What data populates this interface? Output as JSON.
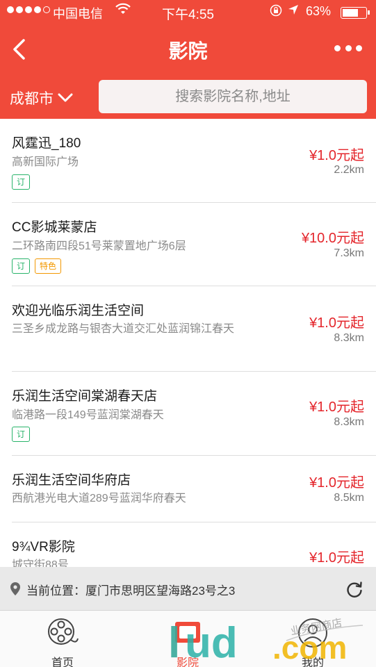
{
  "status_bar": {
    "carrier": "中国电信",
    "time": "下午4:55",
    "battery": "63%"
  },
  "nav": {
    "title": "影院"
  },
  "search": {
    "city": "成都市",
    "placeholder": "搜索影院名称,地址"
  },
  "cinemas": [
    {
      "name": "风霆迅_180",
      "address": "高新国际广场",
      "tags": [
        "订"
      ],
      "price": "¥1.0元起",
      "distance": "2.2km"
    },
    {
      "name": "CC影城莱蒙店",
      "address": "二环路南四段51号莱蒙置地广场6层",
      "tags": [
        "订",
        "特色"
      ],
      "price": "¥10.0元起",
      "distance": "7.3km"
    },
    {
      "name": "欢迎光临乐润生活空间",
      "address": "三圣乡成龙路与银杏大道交汇处蓝润锦江春天",
      "tags": [],
      "price": "¥1.0元起",
      "distance": "8.3km"
    },
    {
      "name": "乐润生活空间棠湖春天店",
      "address": "临港路一段149号蓝润棠湖春天",
      "tags": [
        "订"
      ],
      "price": "¥1.0元起",
      "distance": "8.3km"
    },
    {
      "name": "乐润生活空间华府店",
      "address": "西航港光电大道289号蓝润华府春天",
      "tags": [],
      "price": "¥1.0元起",
      "distance": "8.5km"
    },
    {
      "name": "9¾VR影院",
      "address": "城守街88号",
      "tags": [],
      "price": "¥1.0元起",
      "distance": ""
    }
  ],
  "location": {
    "text": "当前位置：厦门市思明区望海路23号之3"
  },
  "tabs": [
    {
      "label": "首页"
    },
    {
      "label": "影院"
    },
    {
      "label": "我的"
    }
  ],
  "watermark": {
    "brand": "lud.com",
    "sub": "业务网商店"
  },
  "colors": {
    "header_red": "#f04a3a",
    "price_red": "#e4262c",
    "tag_green": "#28b36a",
    "tag_orange": "#f39800"
  }
}
